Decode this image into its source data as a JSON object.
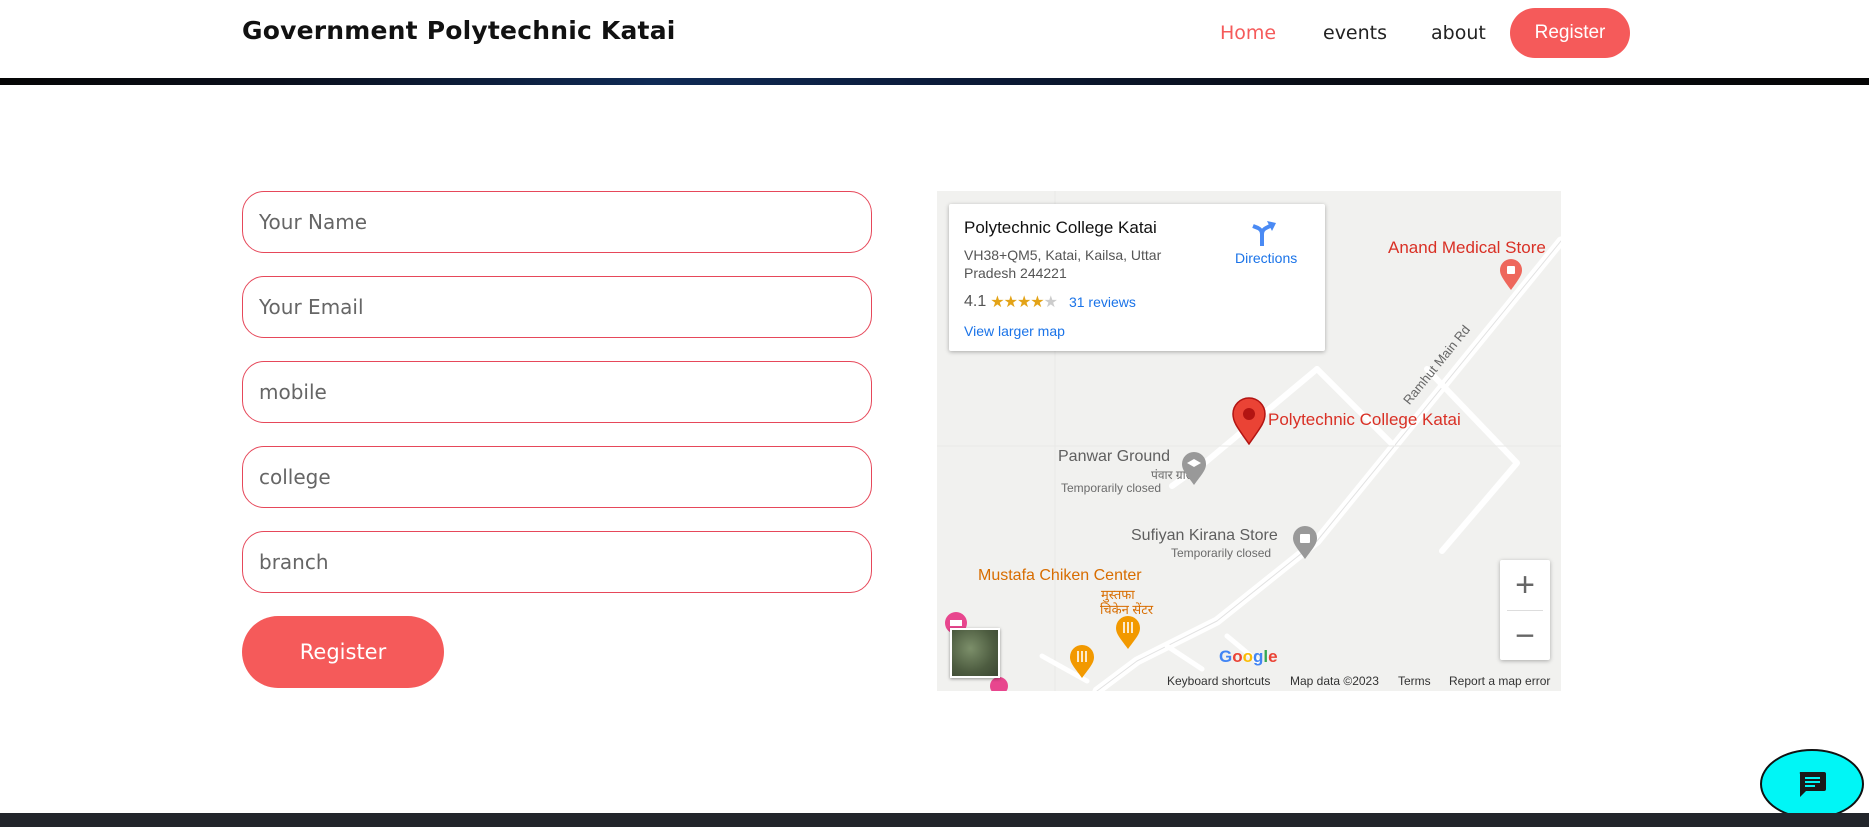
{
  "header": {
    "brand": "Government Polytechnic Katai",
    "nav": {
      "home": "Home",
      "events": "events",
      "about": "about",
      "register": "Register"
    }
  },
  "form": {
    "name_placeholder": "Your Name",
    "email_placeholder": "Your Email",
    "mobile_placeholder": "mobile",
    "college_placeholder": "college",
    "branch_placeholder": "branch",
    "submit_label": "Register"
  },
  "map": {
    "place_title": "Polytechnic College Katai",
    "address": "VH38+QM5, Katai, Kailsa, Uttar Pradesh 244221",
    "rating": "4.1",
    "stars_filled": 4,
    "reviews": "31 reviews",
    "view_larger": "View larger map",
    "directions": "Directions",
    "poi": {
      "anand": "Anand Medical Store",
      "polytechnic": "Polytechnic College Katai",
      "panwar": "Panwar Ground",
      "panwar_hindi": "पंवार ग्राउंड",
      "panwar_status": "Temporarily closed",
      "sufiyan": "Sufiyan Kirana Store",
      "sufiyan_status": "Temporarily closed",
      "mustafa": "Mustafa Chiken Center",
      "mustafa_hindi_1": "मुस्तफा",
      "mustafa_hindi_2": "चिकेन सेंटर",
      "street": "Ramhut Main Rd"
    },
    "zoom_in": "+",
    "zoom_out": "−",
    "google": "Google",
    "attribution": {
      "shortcuts": "Keyboard shortcuts",
      "map_data": "Map data ©2023",
      "terms": "Terms",
      "report": "Report a map error"
    },
    "colors": {
      "poi_red": "#d93025",
      "link_blue": "#1a73e8",
      "poi_orange": "#d86d00"
    }
  },
  "theme": {
    "accent": "#f55a5a",
    "chat_bubble": "#00f6f6"
  },
  "icons": {
    "chat": "chat-icon",
    "directions": "directions-icon",
    "map_pin": "map-pin-icon"
  }
}
